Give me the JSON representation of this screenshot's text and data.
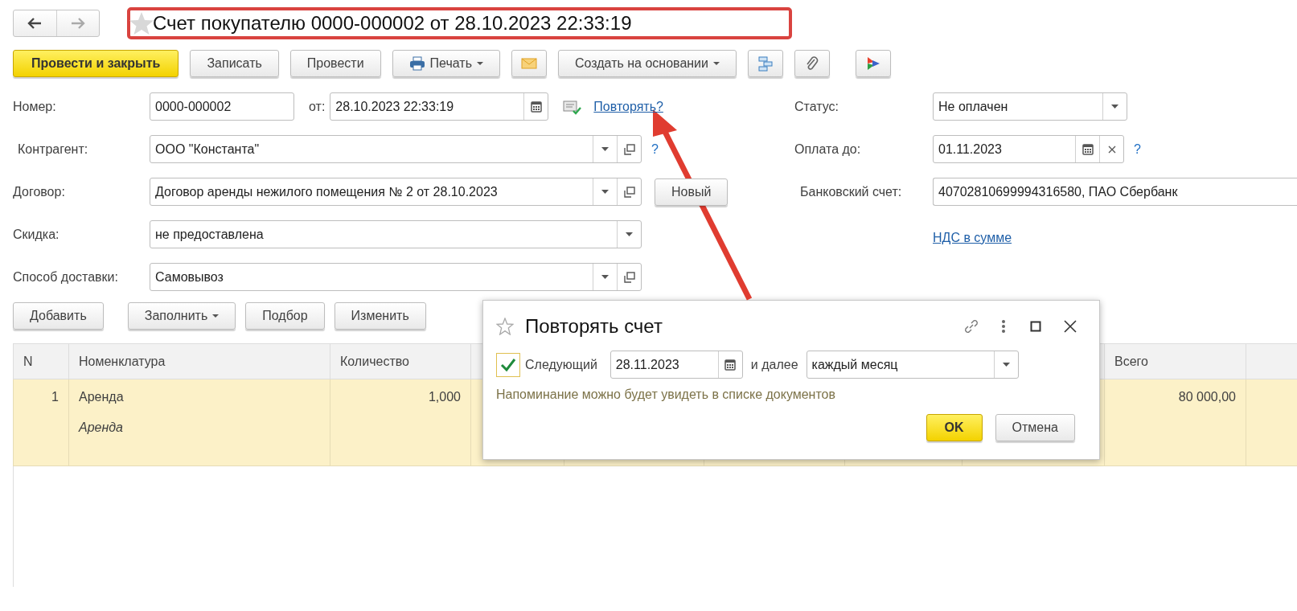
{
  "title": "Счет покупателю 0000-000002 от 28.10.2023 22:33:19",
  "toolbar": [
    {
      "label": "Провести и закрыть",
      "kind": "primary",
      "dropdown": false,
      "icon": false
    },
    {
      "label": "Записать",
      "kind": "plain",
      "dropdown": false,
      "icon": false
    },
    {
      "label": "Провести",
      "kind": "plain",
      "dropdown": false,
      "icon": false
    },
    {
      "label": "Печать",
      "kind": "plain",
      "dropdown": true,
      "icon": true
    },
    {
      "label": "Создать на основании",
      "kind": "plain",
      "dropdown": true,
      "icon": false
    }
  ],
  "form": {
    "number": {
      "label": "Номер:",
      "value": "0000-000002"
    },
    "date": {
      "label": "от:",
      "value": "28.10.2023 22:33:19"
    },
    "repeat_link": "Повторять?",
    "status": {
      "label": "Статус:",
      "value": "Не оплачен"
    },
    "counterparty": {
      "label": "Контрагент:",
      "value": "ООО \"Константа\"",
      "help": "?"
    },
    "pay_until": {
      "label": "Оплата до:",
      "value": "01.11.2023",
      "help": "?"
    },
    "contract": {
      "label": "Договор:",
      "value": "Договор аренды нежилого помещения № 2 от 28.10.2023"
    },
    "new_button": "Новый",
    "bank_account": {
      "label": "Банковский счет:",
      "value": "40702810699994316580, ПАО Сбербанк"
    },
    "discount": {
      "label": "Скидка:",
      "value": "не предоставлена"
    },
    "vat_link": "НДС в сумме",
    "delivery": {
      "label": "Способ доставки:",
      "value": "Самовывоз"
    }
  },
  "table_buttons": [
    {
      "label": "Добавить",
      "dropdown": false
    },
    {
      "label": "Заполнить",
      "dropdown": true
    },
    {
      "label": "Подбор",
      "dropdown": false
    },
    {
      "label": "Изменить",
      "dropdown": false
    }
  ],
  "table": {
    "columns": [
      "N",
      "Номенклатура",
      "Количество",
      "Всего"
    ],
    "rows": [
      {
        "n": "1",
        "item": "Аренда",
        "item_note": "Аренда",
        "quantity": "1,000",
        "total": "80 000,00",
        "selected": true
      }
    ]
  },
  "dialog": {
    "title": "Повторять счет",
    "checkbox": {
      "label": "Следующий",
      "checked": true
    },
    "date": "28.11.2023",
    "then_label": "и далее",
    "period": "каждый месяц",
    "note": "Напоминание можно будет увидеть в списке документов",
    "buttons": [
      {
        "label": "OK",
        "kind": "primary"
      },
      {
        "label": "Отмена",
        "kind": "plain"
      }
    ]
  }
}
